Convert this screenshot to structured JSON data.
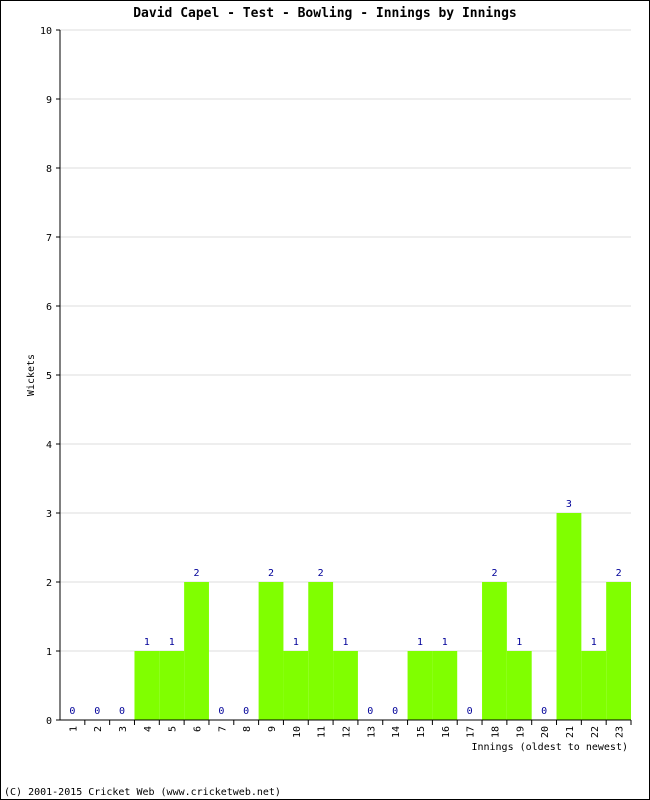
{
  "chart_data": {
    "type": "bar",
    "title": "David Capel - Test - Bowling - Innings by Innings",
    "xlabel": "Innings (oldest to newest)",
    "ylabel": "Wickets",
    "ylim": [
      0,
      10
    ],
    "yticks": [
      0,
      1,
      2,
      3,
      4,
      5,
      6,
      7,
      8,
      9,
      10
    ],
    "grid": true,
    "categories": [
      "1",
      "2",
      "3",
      "4",
      "5",
      "6",
      "7",
      "8",
      "9",
      "10",
      "11",
      "12",
      "13",
      "14",
      "15",
      "16",
      "17",
      "18",
      "19",
      "20",
      "21",
      "22",
      "23"
    ],
    "values": [
      0,
      0,
      0,
      1,
      1,
      2,
      0,
      0,
      2,
      1,
      2,
      1,
      0,
      0,
      1,
      1,
      0,
      2,
      1,
      0,
      3,
      1,
      2
    ],
    "bar_color": "#80ff00",
    "label_color": "#000099",
    "grid_color": "#dddddd"
  },
  "footer": "(C) 2001-2015 Cricket Web (www.cricketweb.net)"
}
